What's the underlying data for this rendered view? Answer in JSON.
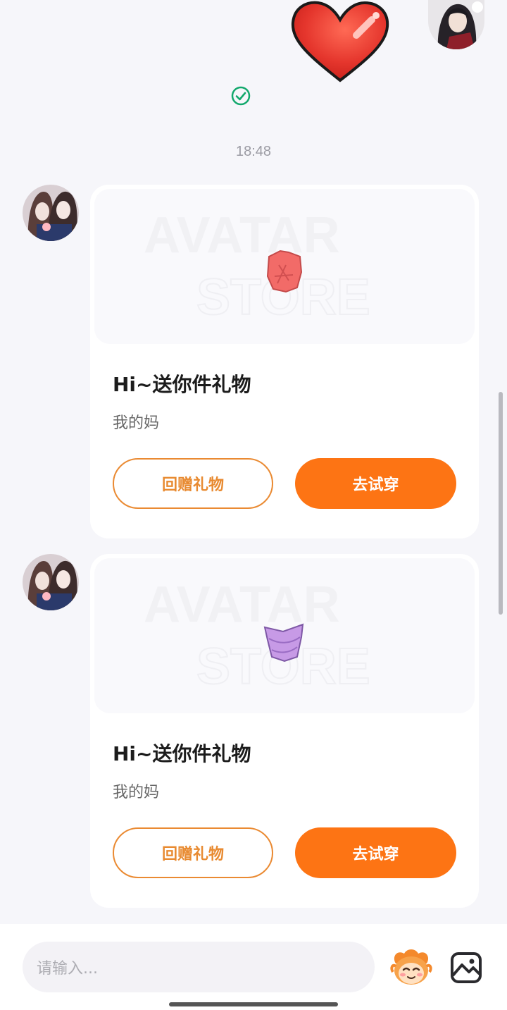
{
  "timestamp": "18:48",
  "colors": {
    "accent": "#fd7414",
    "outline": "#ea8a32",
    "check": "#12a86c",
    "heart": "#e5362d"
  },
  "messages": [
    {
      "title": "Hi~送你件礼物",
      "subtitle": "我的妈",
      "item_icon": "red-shirt-icon",
      "watermark": "AVATAR STORE",
      "return_gift_label": "回赠礼物",
      "try_on_label": "去试穿"
    },
    {
      "title": "Hi~送你件礼物",
      "subtitle": "我的妈",
      "item_icon": "purple-top-icon",
      "watermark": "AVATAR STORE",
      "return_gift_label": "回赠礼物",
      "try_on_label": "去试穿"
    }
  ],
  "input": {
    "placeholder": "请输入..."
  }
}
